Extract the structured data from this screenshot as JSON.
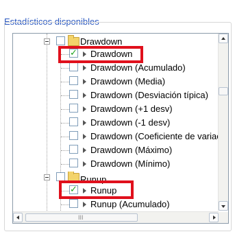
{
  "group": {
    "title": "Estadísticos disponibles"
  },
  "tree": {
    "rows": [
      {
        "label": "Drawdown",
        "checked": false,
        "kind": "folder"
      },
      {
        "label": "Drawdown",
        "checked": true,
        "kind": "item"
      },
      {
        "label": "Drawdown (Acumulado)",
        "checked": false,
        "kind": "item"
      },
      {
        "label": "Drawdown (Media)",
        "checked": false,
        "kind": "item"
      },
      {
        "label": "Drawdown (Desviación típica)",
        "checked": false,
        "kind": "item"
      },
      {
        "label": "Drawdown (+1 desv)",
        "checked": false,
        "kind": "item"
      },
      {
        "label": "Drawdown (-1 desv)",
        "checked": false,
        "kind": "item"
      },
      {
        "label": "Drawdown (Coeficiente de variación)",
        "checked": false,
        "kind": "item"
      },
      {
        "label": "Drawdown (Máximo)",
        "checked": false,
        "kind": "item"
      },
      {
        "label": "Drawdown (Mínimo)",
        "checked": false,
        "kind": "item"
      },
      {
        "label": "Runup",
        "checked": false,
        "kind": "folder"
      },
      {
        "label": "Runup",
        "checked": true,
        "kind": "item"
      },
      {
        "label": "Runup (Acumulado)",
        "checked": false,
        "kind": "item"
      }
    ]
  },
  "scrollbars": {
    "h_grip": "III"
  },
  "colors": {
    "highlight": "#e0101c",
    "title": "#2a58c0",
    "check": "#1fa31f"
  }
}
